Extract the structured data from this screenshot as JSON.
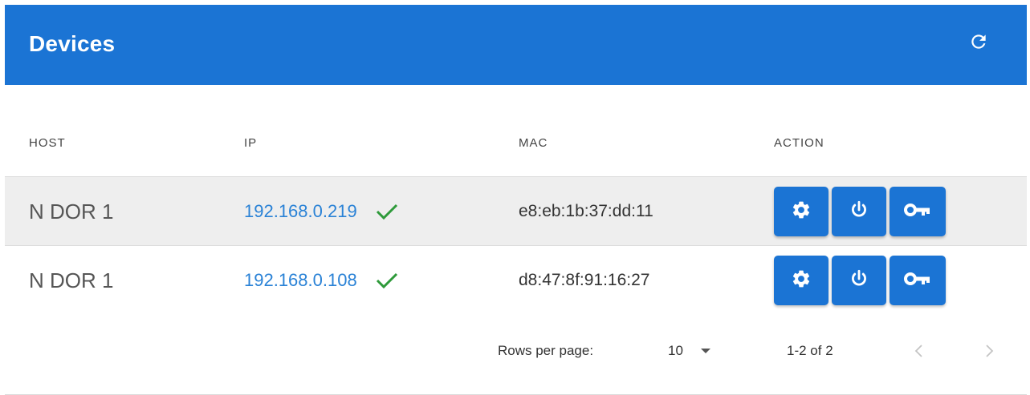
{
  "header": {
    "title": "Devices",
    "refresh_icon": "refresh-icon"
  },
  "table": {
    "columns": [
      "HOST",
      "IP",
      "MAC",
      "ACTION"
    ],
    "rows": [
      {
        "host": "N DOR 1",
        "ip": "192.168.0.219",
        "online": true,
        "mac": "e8:eb:1b:37:dd:11"
      },
      {
        "host": "N DOR 1",
        "ip": "192.168.0.108",
        "online": true,
        "mac": "d8:47:8f:91:16:27"
      }
    ],
    "action_icons": [
      "gear-icon",
      "power-icon",
      "key-icon"
    ]
  },
  "pagination": {
    "rows_per_page_label": "Rows per page:",
    "rows_per_page_value": "10",
    "range_text": "1-2 of 2"
  },
  "colors": {
    "primary": "#1b74d4",
    "link": "#2a82d6",
    "success": "#2e9a3a",
    "row_alt": "#eeeeee"
  }
}
